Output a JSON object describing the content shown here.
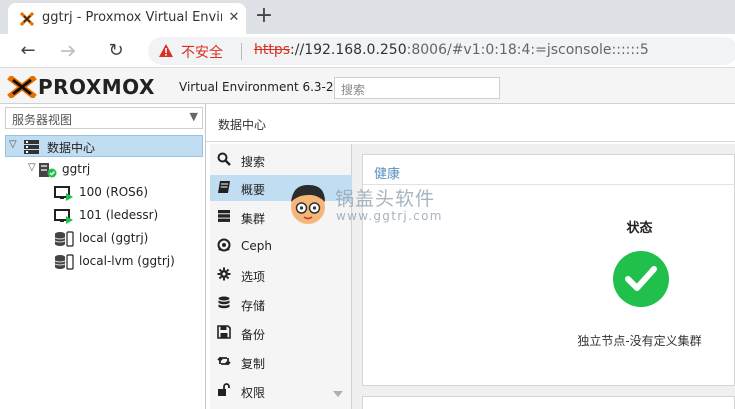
{
  "browser": {
    "tab_title": "ggtrj - Proxmox Virtual Environme",
    "close_glyph": "✕",
    "new_tab_glyph": "+",
    "back_glyph": "←",
    "reload_glyph": "↻",
    "insecure_label": "不安全",
    "url_scheme": "https",
    "url_host": "://192.168.0.250",
    "url_rest": ":8006/#v1:0:18:4:=jsconsole::::::5"
  },
  "header": {
    "logo_text": "PROXMOX",
    "product": "Virtual Environment 6.3-2",
    "search_placeholder": "搜索"
  },
  "sidebar": {
    "view_label": "服务器视图",
    "tree": [
      {
        "label": "数据中心",
        "icon": "server-stack-icon",
        "level": 0,
        "selected": true
      },
      {
        "label": "ggtrj",
        "icon": "node-online-icon",
        "level": 1
      },
      {
        "label": "100 (ROS6)",
        "icon": "vm-running-icon",
        "level": 2
      },
      {
        "label": "101 (ledessr)",
        "icon": "vm-running-icon",
        "level": 2
      },
      {
        "label": "local (ggtrj)",
        "icon": "storage-icon",
        "level": 2
      },
      {
        "label": "local-lvm (ggtrj)",
        "icon": "storage-icon",
        "level": 2
      }
    ]
  },
  "main": {
    "breadcrumb": "数据中心",
    "menu": [
      {
        "label": "搜索",
        "icon": "search-icon"
      },
      {
        "label": "概要",
        "icon": "book-icon",
        "active": true
      },
      {
        "label": "集群",
        "icon": "server-icon"
      },
      {
        "label": "Ceph",
        "icon": "ceph-icon"
      },
      {
        "label": "选项",
        "icon": "gear-icon"
      },
      {
        "label": "存储",
        "icon": "database-icon"
      },
      {
        "label": "备份",
        "icon": "floppy-icon"
      },
      {
        "label": "复制",
        "icon": "retweet-icon"
      },
      {
        "label": "权限",
        "icon": "unlock-icon"
      }
    ],
    "health": {
      "title": "健康",
      "status_label": "状态",
      "note": "独立节点-没有定义集群"
    }
  },
  "watermark": {
    "line1": "锅盖头软件",
    "line2": "www.ggtrj.com"
  },
  "colors": {
    "accent": "#5b8fc0",
    "selected": "#c1ddf1",
    "ok": "#21bf4b",
    "insecure": "#d93025",
    "proxmox_orange": "#e57000"
  }
}
